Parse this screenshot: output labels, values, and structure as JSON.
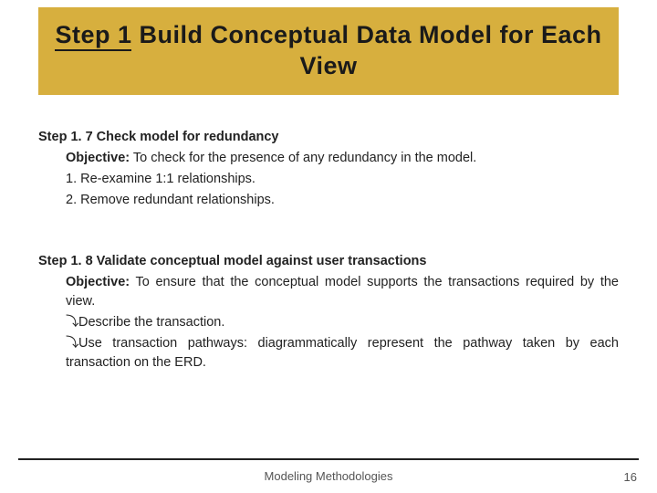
{
  "title": {
    "underlined_part": "Step 1",
    "rest": " Build Conceptual Data Model for Each View"
  },
  "sections": [
    {
      "heading_prefix": "Step 1. 7  ",
      "heading": "Check model for redundancy",
      "objective_label": "Objective:",
      "objective_text": " To check for the presence of any redundancy in the model.",
      "items": [
        {
          "bullet": "",
          "text": "1. Re-examine 1:1 relationships."
        },
        {
          "bullet": "",
          "text": "2. Remove redundant relationships."
        }
      ]
    },
    {
      "heading_prefix": "Step 1. 8  ",
      "heading": "Validate conceptual model against user transactions",
      "objective_label": "Objective:",
      "objective_text": " To ensure that the conceptual model supports the transactions required by the view.",
      "items": [
        {
          "bullet": "⤵",
          "text": "Describe the transaction."
        },
        {
          "bullet": "⤵",
          "text": "Use transaction pathways: diagrammatically represent the pathway taken by each transaction on the ERD."
        }
      ]
    }
  ],
  "footer": {
    "text": "Modeling Methodologies",
    "page": "16"
  }
}
